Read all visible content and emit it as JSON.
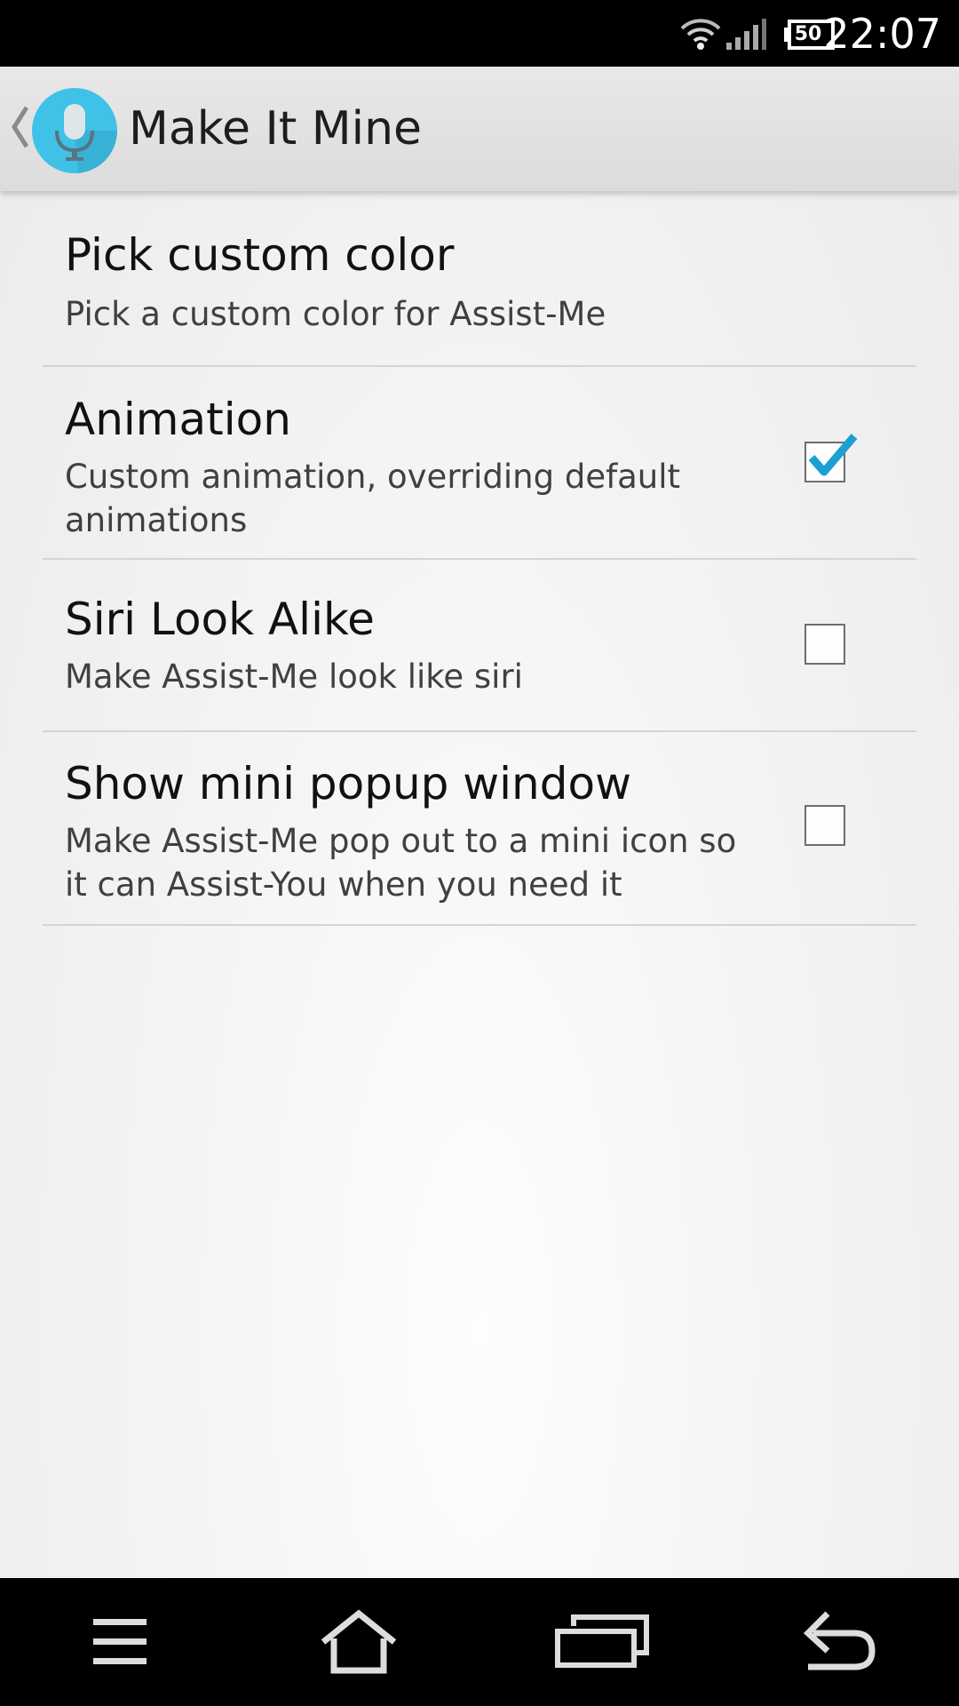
{
  "status_bar": {
    "time": "22:07",
    "battery_level": "50",
    "icons": [
      "wifi-icon",
      "cell-signal-icon",
      "battery-icon"
    ]
  },
  "action_bar": {
    "title": "Make It Mine",
    "icon": "microphone-app-icon",
    "accent": "#3fc1e8"
  },
  "preferences": [
    {
      "title": "Pick custom color",
      "summary": "Pick a custom color for Assist-Me",
      "has_checkbox": false
    },
    {
      "title": "Animation",
      "summary": "Custom animation, overriding default animations",
      "has_checkbox": true,
      "checked": true
    },
    {
      "title": "Siri Look Alike",
      "summary": "Make Assist-Me look like siri",
      "has_checkbox": true,
      "checked": false
    },
    {
      "title": "Show mini popup window",
      "summary": "Make Assist-Me pop out to a mini icon so it can Assist-You when you need it",
      "has_checkbox": true,
      "checked": false
    }
  ],
  "nav_bar": {
    "buttons": [
      "menu-icon",
      "home-icon",
      "recent-apps-icon",
      "back-icon"
    ]
  },
  "colors": {
    "check_accent": "#1e9fd4",
    "divider": "#d4d4d4"
  }
}
